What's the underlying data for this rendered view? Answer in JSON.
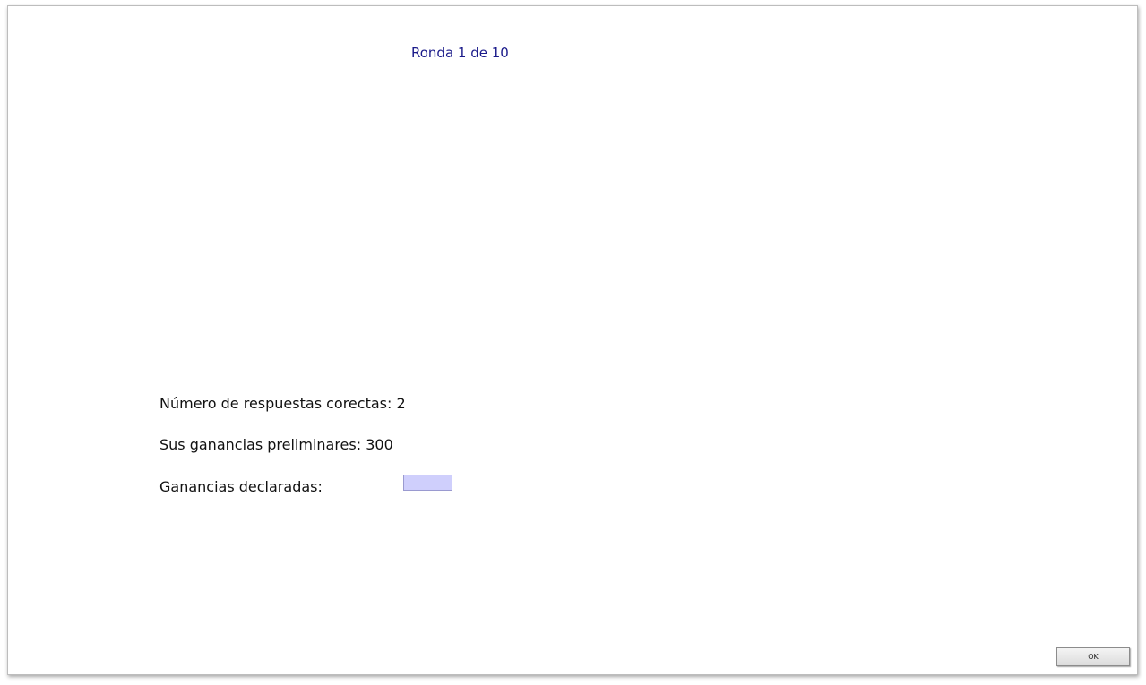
{
  "header": {
    "round_text": "Ronda 1 de 10"
  },
  "results": {
    "correct_answers_text": "Número de respuestas corectas: 2",
    "preliminary_earnings_text": "Sus ganancias preliminares: 300",
    "declared_earnings_label": "Ganancias declaradas:",
    "declared_earnings_value": ""
  },
  "footer": {
    "ok_label": "OK"
  },
  "colors": {
    "round_text": "#1a1a8a",
    "input_background": "#cfcffc"
  }
}
